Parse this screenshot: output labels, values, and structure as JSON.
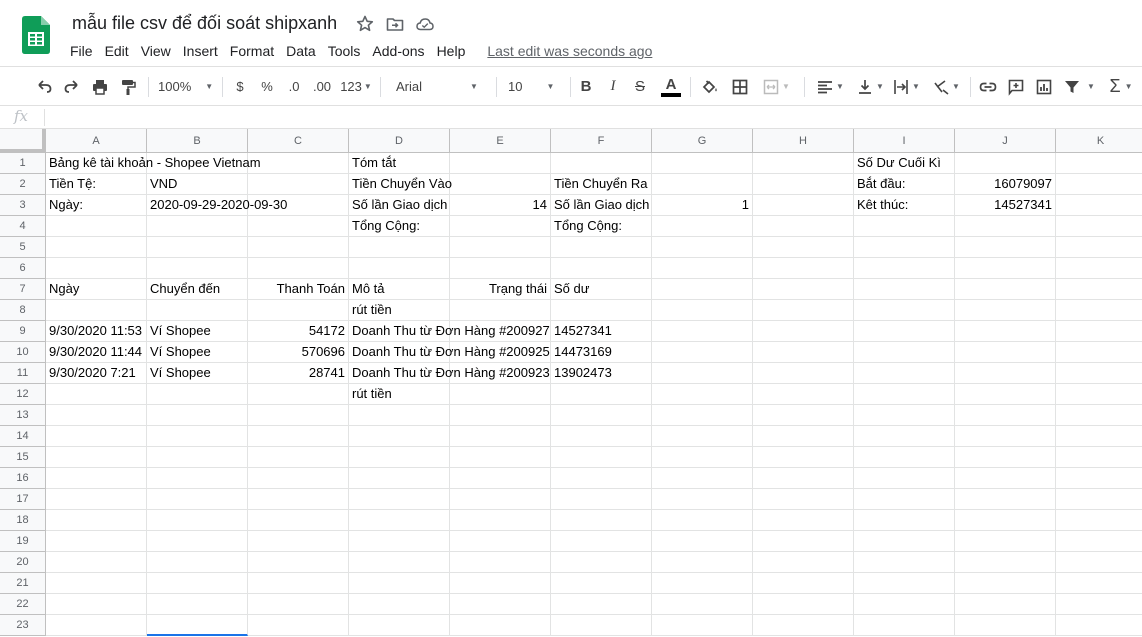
{
  "app": {
    "doc_title": "mẫu file csv để đối soát shipxanh",
    "last_edit": "Last edit was seconds ago",
    "menu": [
      "File",
      "Edit",
      "View",
      "Insert",
      "Format",
      "Data",
      "Tools",
      "Add-ons",
      "Help"
    ]
  },
  "toolbar": {
    "zoom": "100%",
    "currency": "$",
    "percent": "%",
    "decrease_decimal": ".0",
    "increase_decimal": ".00",
    "more_formats": "123",
    "font": "Arial",
    "font_size": "10",
    "bold": "B",
    "italic": "I",
    "strikethrough": "S",
    "text_color_letter": "A"
  },
  "formula_bar": {
    "fx": "fx",
    "value": ""
  },
  "colors": {
    "brand_green": "#0F9D58",
    "selection_blue": "#1A73E8",
    "header_bg": "#F8F9FA"
  },
  "columns": [
    "A",
    "B",
    "C",
    "D",
    "E",
    "F",
    "G",
    "H",
    "I",
    "J",
    "K"
  ],
  "rows": [
    "1",
    "2",
    "3",
    "4",
    "5",
    "6",
    "7",
    "8",
    "9",
    "10",
    "11",
    "12",
    "13",
    "14",
    "15",
    "16",
    "17",
    "18",
    "19",
    "20",
    "21",
    "22",
    "23"
  ],
  "cells": {
    "r1": {
      "A": "Bảng kê tài khoản - Shopee Vietnam",
      "D": "Tóm tắt",
      "I": "Số Dư Cuối Kì"
    },
    "r2": {
      "A": "Tiền Tệ:",
      "B": "VND",
      "D": "Tiền Chuyển Vào",
      "F": "Tiền Chuyển Ra",
      "I": "Bắt đầu:",
      "J": "16079097"
    },
    "r3": {
      "A": "Ngày:",
      "B": "2020-09-29-2020-09-30",
      "D": "Số lần Giao dịch",
      "E": "14",
      "F": "Số lần Giao dịch",
      "G": "1",
      "I": "Kêt thúc:",
      "J": "14527341"
    },
    "r4": {
      "D": "Tổng Cộng:",
      "F": "Tổng Cộng:"
    },
    "r7": {
      "A": "Ngày",
      "B": "Chuyển đến",
      "C": "Thanh Toán",
      "D": "Mô tả",
      "E": "Trạng thái",
      "F": "Số dư"
    },
    "r8": {
      "D": "rút tiền"
    },
    "r9": {
      "A": "9/30/2020 11:53",
      "B": "Ví Shopee",
      "C": "54172",
      "D": "Doanh Thu từ Đơn Hàng #200927",
      "F": "14527341"
    },
    "r10": {
      "A": "9/30/2020 11:44",
      "B": "Ví Shopee",
      "C": "570696",
      "D": "Doanh Thu từ Đơn Hàng #200925",
      "F": "14473169"
    },
    "r11": {
      "A": "9/30/2020 7:21",
      "B": "Ví Shopee",
      "C": "28741",
      "D": "Doanh Thu từ Đơn Hàng #200923",
      "F": "13902473"
    },
    "r12": {
      "D": "rút tiền"
    }
  }
}
